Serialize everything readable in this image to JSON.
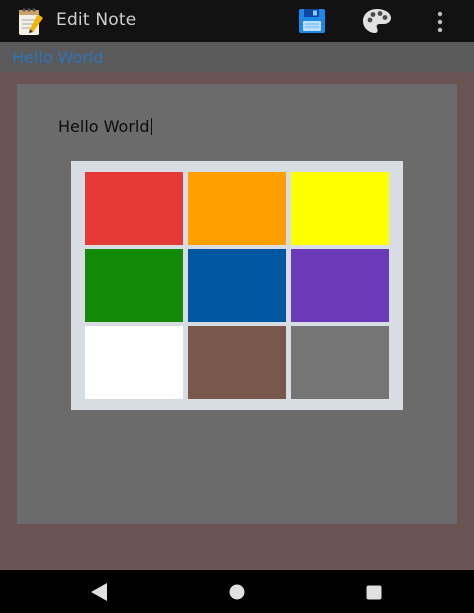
{
  "appbar": {
    "title": "Edit Note",
    "app_icon": "notepad-pencil-icon",
    "actions": [
      {
        "name": "save",
        "icon": "floppy-disk-icon"
      },
      {
        "name": "color",
        "icon": "palette-icon"
      },
      {
        "name": "more",
        "icon": "overflow-menu-icon"
      }
    ]
  },
  "note": {
    "title": "Hello World",
    "body": "Hello World"
  },
  "color_picker": {
    "colors": [
      {
        "name": "red",
        "hex": "#e53935"
      },
      {
        "name": "orange",
        "hex": "#ff9f00"
      },
      {
        "name": "yellow",
        "hex": "#ffff00"
      },
      {
        "name": "green",
        "hex": "#128a08"
      },
      {
        "name": "blue",
        "hex": "#0156a2"
      },
      {
        "name": "purple",
        "hex": "#6a3ab9"
      },
      {
        "name": "white",
        "hex": "#ffffff"
      },
      {
        "name": "brown",
        "hex": "#7a574b"
      },
      {
        "name": "gray",
        "hex": "#757575"
      }
    ]
  },
  "navbar": {
    "buttons": [
      {
        "name": "back",
        "icon": "back-triangle-icon"
      },
      {
        "name": "home",
        "icon": "home-circle-icon"
      },
      {
        "name": "recents",
        "icon": "recents-square-icon"
      }
    ]
  }
}
